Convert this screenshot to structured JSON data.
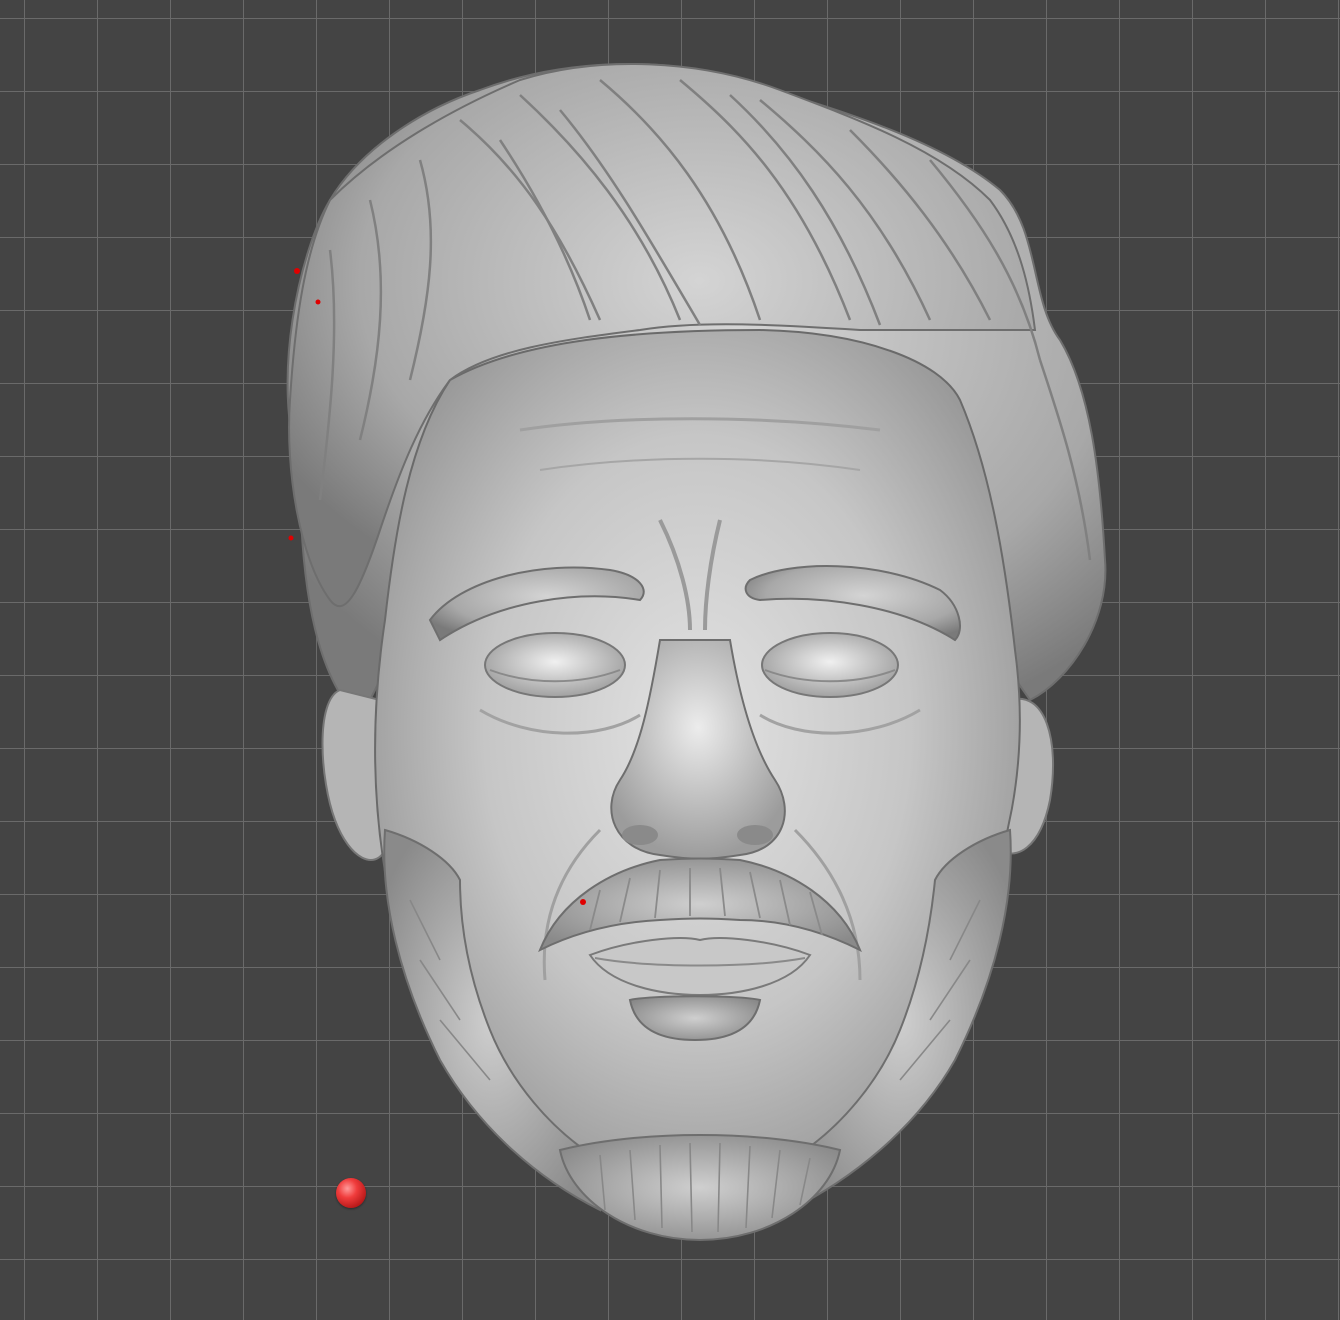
{
  "viewport": {
    "background_color": "#444444",
    "grid_color": "#6a6a6a",
    "grid": true
  },
  "model": {
    "subject": "sculpted-head",
    "material_color": "#bdbdbd",
    "shadow_color": "#7d7d7d",
    "highlight_color": "#e6e6e6"
  },
  "markers": {
    "light_handle_color": "#e03030",
    "error_point_color": "#e00000"
  }
}
